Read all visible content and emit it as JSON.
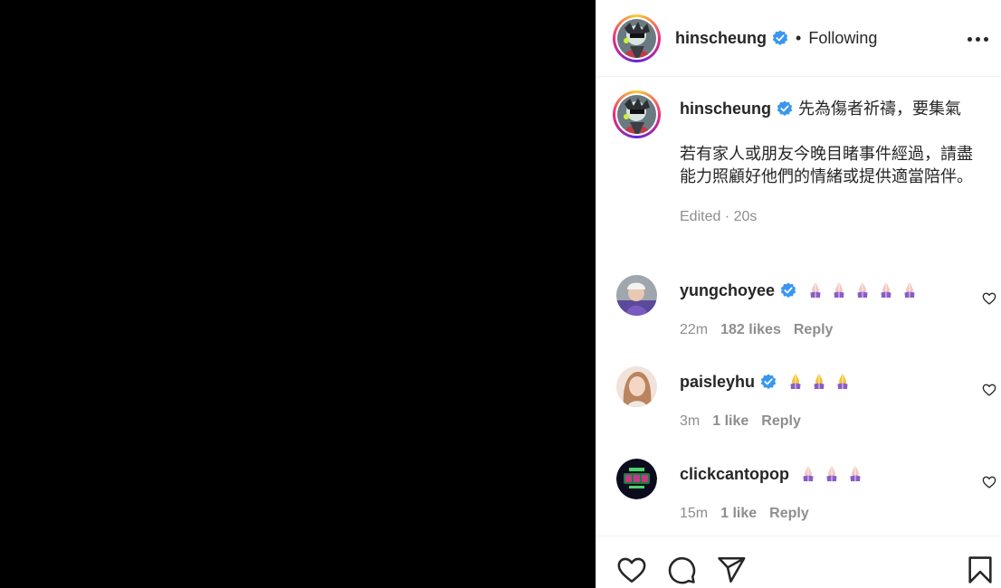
{
  "post": {
    "author": "hinscheung",
    "follow_separator": "•",
    "follow_status": "Following"
  },
  "caption": {
    "author": "hinscheung",
    "line1": "先為傷者祈禱，要集氣",
    "paragraph": "若有家人或朋友今晚目睹事件經過，請盡能力照顧好他們的情緒或提供適當陪伴。",
    "meta": "Edited · 20s"
  },
  "comments": [
    {
      "username": "yungchoyee",
      "verified": true,
      "emoji_count": 5,
      "time": "22m",
      "likes": "182 likes",
      "reply": "Reply"
    },
    {
      "username": "paisleyhu",
      "verified": true,
      "emoji_count": 3,
      "time": "3m",
      "likes": "1 like",
      "reply": "Reply"
    },
    {
      "username": "clickcantopop",
      "verified": false,
      "emoji_count": 3,
      "time": "15m",
      "likes": "1 like",
      "reply": "Reply"
    }
  ],
  "icons": {
    "verified": "verified-badge-icon",
    "more": "more-options-icon",
    "like": "heart-icon",
    "comment": "comment-icon",
    "share": "send-icon",
    "save": "bookmark-icon",
    "emoji": "folded-hands-emoji"
  },
  "colors": {
    "verified_blue": "#3897f0",
    "muted_text": "#8e8e8e",
    "media_background": "#000000"
  }
}
